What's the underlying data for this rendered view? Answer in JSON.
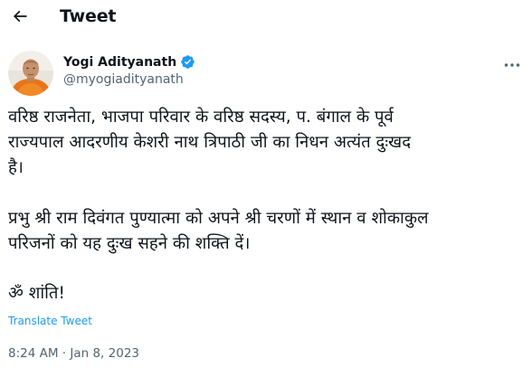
{
  "header": {
    "title": "Tweet"
  },
  "author": {
    "name": "Yogi Adityanath",
    "handle": "@myogiadityanath",
    "verified_color": "#1d9bf0"
  },
  "tweet": {
    "paragraph_1": "वरिष्ठ राजनेता, भाजपा परिवार के वरिष्ठ सदस्य, प. बंगाल के पूर्व\nराज्यपाल आदरणीय केशरी नाथ त्रिपाठी जी का निधन अत्यंत दुःखद\nहै।",
    "paragraph_2": "प्रभु श्री राम दिवंगत पुण्यात्मा को अपने श्री चरणों में स्थान व शोकाकुल\nपरिजनों को यह दुःख सहने की शक्ति दें।",
    "paragraph_3": "ॐ शांति!",
    "translate_label": "Translate Tweet",
    "timestamp": "8:24 AM · Jan 8, 2023"
  },
  "colors": {
    "link": "#1d9bf0",
    "secondary_text": "#536471",
    "primary_text": "#0f1419"
  },
  "icons": {
    "back": "arrow-left-icon",
    "verified": "verified-badge-icon",
    "more": "more-horizontal-icon"
  }
}
